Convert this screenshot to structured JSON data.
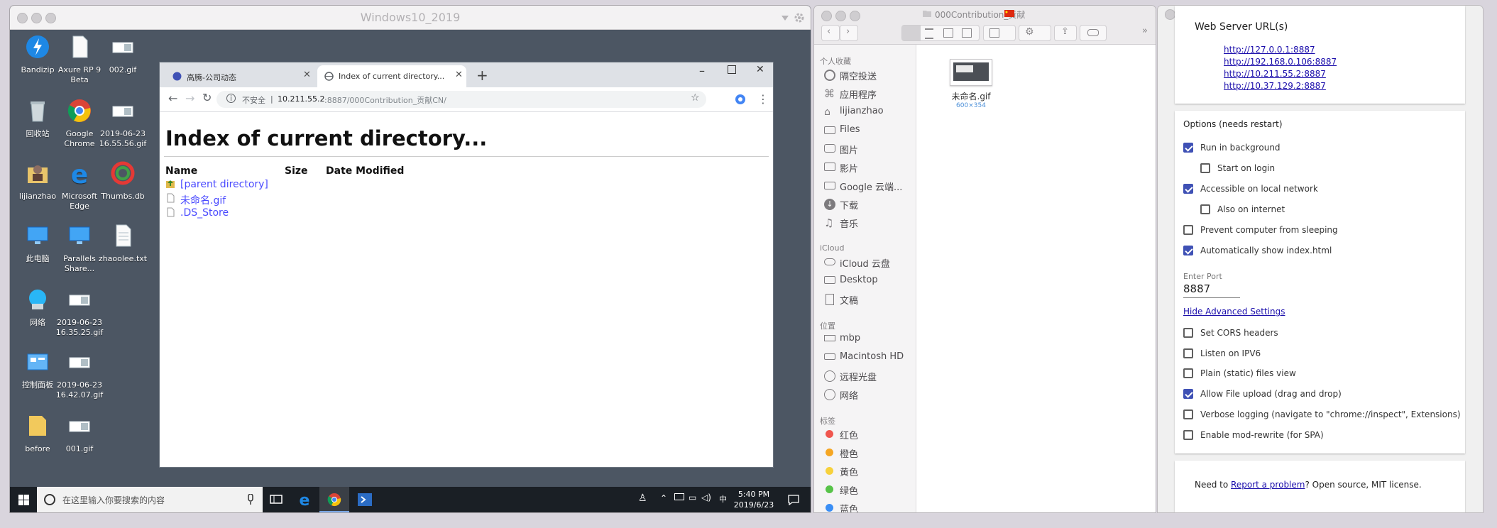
{
  "vm": {
    "title": "Windows10_2019",
    "desktop_icons": [
      {
        "label": "Bandizip"
      },
      {
        "label": "Axure RP 9 Beta"
      },
      {
        "label": "002.gif"
      },
      {
        "label": "回收站"
      },
      {
        "label": "Google Chrome"
      },
      {
        "label": "2019-06-23 16.55.56.gif"
      },
      {
        "label": "lijianzhao"
      },
      {
        "label": "Microsoft Edge"
      },
      {
        "label": "Thumbs.db"
      },
      {
        "label": "此电脑"
      },
      {
        "label": "Parallels Share..."
      },
      {
        "label": "zhaoolee.txt"
      },
      {
        "label": "网络"
      },
      {
        "label": "2019-06-23 16.35.25.gif"
      },
      {
        "label": "控制面板"
      },
      {
        "label": "2019-06-23 16.42.07.gif"
      },
      {
        "label": "before"
      },
      {
        "label": "001.gif"
      }
    ],
    "taskbar": {
      "search_placeholder": "在这里输入你要搜索的内容",
      "time": "5:40 PM",
      "date": "2019/6/23",
      "ime": "中"
    }
  },
  "browser": {
    "tabs": [
      {
        "label": "高腾-公司动态"
      },
      {
        "label": "Index of current directory..."
      }
    ],
    "security_label": "不安全",
    "url_host": "10.211.55.2",
    "url_rest": ":8887/000Contribution_贡献CN/",
    "page": {
      "heading": "Index of current directory...",
      "columns": [
        "Name",
        "Size",
        "Date Modified"
      ],
      "entries": [
        "[parent directory]",
        "未命名.gif",
        ".DS_Store"
      ]
    }
  },
  "finder": {
    "title": "000Contribution_贡献",
    "sections": [
      {
        "header": "个人收藏",
        "items": [
          "隔空投送",
          "应用程序",
          "lijianzhao",
          "Files",
          "图片",
          "影片",
          "Google 云端...",
          "下载",
          "音乐"
        ]
      },
      {
        "header": "iCloud",
        "items": [
          "iCloud 云盘",
          "Desktop",
          "文稿"
        ]
      },
      {
        "header": "位置",
        "items": [
          "mbp",
          "Macintosh HD",
          "远程光盘",
          "网络"
        ]
      },
      {
        "header": "标签",
        "items": [
          "红色",
          "橙色",
          "黄色",
          "绿色",
          "蓝色"
        ]
      }
    ],
    "tag_colors": [
      "#f0564e",
      "#f5a623",
      "#f7d13c",
      "#57c348",
      "#3a8ef5"
    ],
    "file": {
      "name": "未命名.gif",
      "dims": "600×354"
    }
  },
  "webserver": {
    "urls_title": "Web Server URL(s)",
    "urls": [
      "http://127.0.0.1:8887",
      "http://192.168.0.106:8887",
      "http://10.211.55.2:8887",
      "http://10.37.129.2:8887"
    ],
    "options_title": "Options (needs restart)",
    "options": [
      {
        "label": "Run in background",
        "checked": true,
        "indent": false
      },
      {
        "label": "Start on login",
        "checked": false,
        "indent": true
      },
      {
        "label": "Accessible on local network",
        "checked": true,
        "indent": false
      },
      {
        "label": "Also on internet",
        "checked": false,
        "indent": true
      },
      {
        "label": "Prevent computer from sleeping",
        "checked": false,
        "indent": false
      },
      {
        "label": "Automatically show index.html",
        "checked": true,
        "indent": false
      }
    ],
    "port_label": "Enter Port",
    "port_value": "8887",
    "hide_advanced": "Hide Advanced Settings",
    "advanced": [
      {
        "label": "Set CORS headers",
        "checked": false
      },
      {
        "label": "Listen on IPV6",
        "checked": false
      },
      {
        "label": "Plain (static) files view",
        "checked": false
      },
      {
        "label": "Allow File upload (drag and drop)",
        "checked": true
      },
      {
        "label": "Verbose logging (navigate to \"chrome://inspect\", Extensions)",
        "checked": false
      },
      {
        "label": "Enable mod-rewrite (for SPA)",
        "checked": false
      }
    ],
    "footer_pre": "Need to ",
    "footer_link": "Report a problem",
    "footer_post": "? Open source, MIT license."
  }
}
